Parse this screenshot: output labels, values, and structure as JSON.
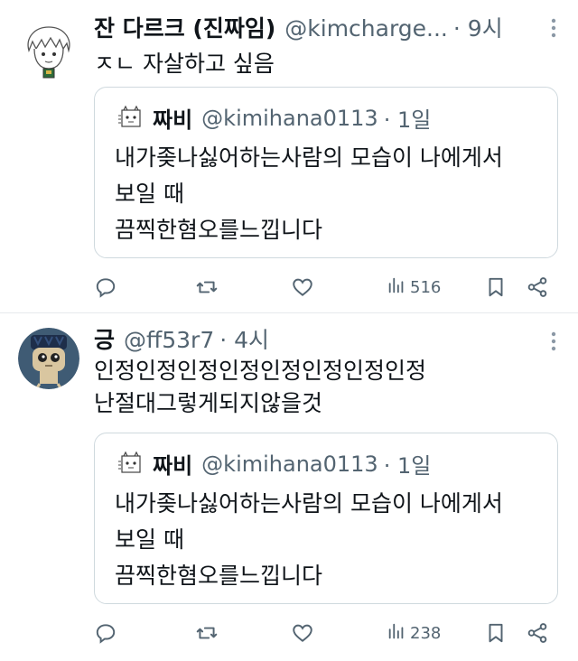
{
  "tweets": [
    {
      "author_name": "잔 다르크 (진짜임)",
      "handle": "@kimcharge...",
      "time": "· 9시",
      "text": "ㅈㄴ 자살하고 싶음",
      "quote": {
        "author_name": "짜비",
        "handle": "@kimihana0113",
        "time": "· 1일",
        "text": "내가좆나싫어하는사람의 모습이 나에게서\n보일 때\n끔찍한혐오를느낍니다"
      },
      "views": "516"
    },
    {
      "author_name": "긍",
      "handle": "@ff53r7",
      "time": "· 4시",
      "text_line1": "인정인정인정인정인정인정인정인정",
      "text_line2": "난절대그렇게되지않을것",
      "quote": {
        "author_name": "짜비",
        "handle": "@kimihana0113",
        "time": "· 1일",
        "text": "내가좆나싫어하는사람의 모습이 나에게서\n보일 때\n끔찍한혐오를느낍니다"
      },
      "views": "238"
    }
  ],
  "icons": {
    "reply": "reply-icon",
    "retweet": "retweet-icon",
    "like": "heart-icon",
    "views": "views-icon",
    "bookmark": "bookmark-icon",
    "share": "share-icon",
    "more": "more-vertical-icon"
  },
  "colors": {
    "text": "#0f1419",
    "muted": "#536471",
    "border": "#cfd9de"
  }
}
